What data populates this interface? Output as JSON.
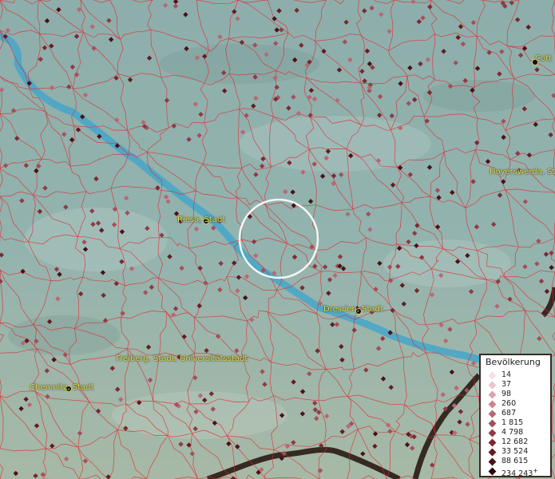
{
  "map": {
    "cities": [
      {
        "name": "Riesa, Stadt"
      },
      {
        "name": "Dresden, Stadt"
      },
      {
        "name": "Freiberg, Stadt, Universitätsstadt"
      },
      {
        "name": "Chemnitz, Stadt"
      },
      {
        "name": "Hoyerswerda, St"
      },
      {
        "name": "Cott"
      }
    ]
  },
  "legend": {
    "title": "Bevölkerung",
    "entries": [
      {
        "label": "14",
        "color": "#f6dfe6"
      },
      {
        "label": "37",
        "color": "#ebc3cf"
      },
      {
        "label": "98",
        "color": "#d9a2b2"
      },
      {
        "label": "260",
        "color": "#c9848f"
      },
      {
        "label": "687",
        "color": "#b86873"
      },
      {
        "label": "1 815",
        "color": "#a44f5a"
      },
      {
        "label": "4 798",
        "color": "#8f3a45"
      },
      {
        "label": "12 682",
        "color": "#7a2931"
      },
      {
        "label": "33 524",
        "color": "#621c22"
      },
      {
        "label": "88 615",
        "color": "#4a1116"
      },
      {
        "label": "234 243",
        "color": "#2a0609"
      }
    ]
  },
  "colors": {
    "background": "#8fb0ad",
    "river": "#4aa6c8",
    "boundary": "#e0262a",
    "border": "#2a1a14",
    "label": "#e8e05a"
  }
}
